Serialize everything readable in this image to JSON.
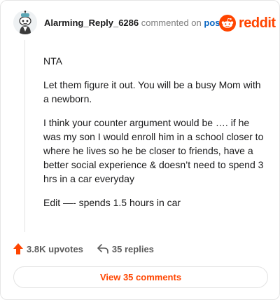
{
  "header": {
    "username": "Alarming_Reply_6286",
    "commented_text": "commented on",
    "post_link": "post",
    "brand": "reddit"
  },
  "comment": {
    "paragraphs": [
      "NTA",
      "Let them figure it out. You will be a busy Mom with a newborn.",
      "I think your counter argument would be …. if he was my son I would enroll him in a school closer to where he lives so he be closer to friends, have a better social experience & doesn’t need to spend 3 hrs in a car everyday",
      "Edit —- spends 1.5 hours in car"
    ]
  },
  "actions": {
    "upvotes": "3.8K upvotes",
    "replies": "35 replies"
  },
  "footer": {
    "view_comments": "View 35 comments"
  },
  "colors": {
    "accent": "#ff4500",
    "link": "#0a66c2"
  },
  "icons": {
    "upvote": "upvote-arrow-icon",
    "reply": "reply-arrow-icon",
    "brand": "reddit-snoo-icon",
    "avatar": "snoo-avatar-icon"
  }
}
